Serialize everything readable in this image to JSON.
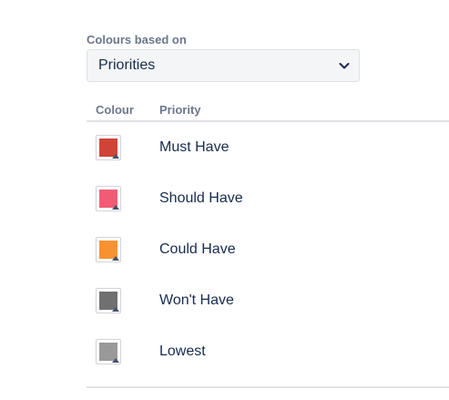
{
  "colour_setting": {
    "label": "Colours based on",
    "selected": "Priorities"
  },
  "table": {
    "headers": {
      "colour": "Colour",
      "priority": "Priority"
    },
    "rows": [
      {
        "name": "Must Have",
        "color": "#d04437"
      },
      {
        "name": "Should Have",
        "color": "#f15c75"
      },
      {
        "name": "Could Have",
        "color": "#f79232"
      },
      {
        "name": "Won't Have",
        "color": "#707070"
      },
      {
        "name": "Lowest",
        "color": "#999999"
      }
    ]
  },
  "icons": {
    "dropdown": "chevron-down-icon",
    "swatch_menu": "caret-down-icon"
  }
}
